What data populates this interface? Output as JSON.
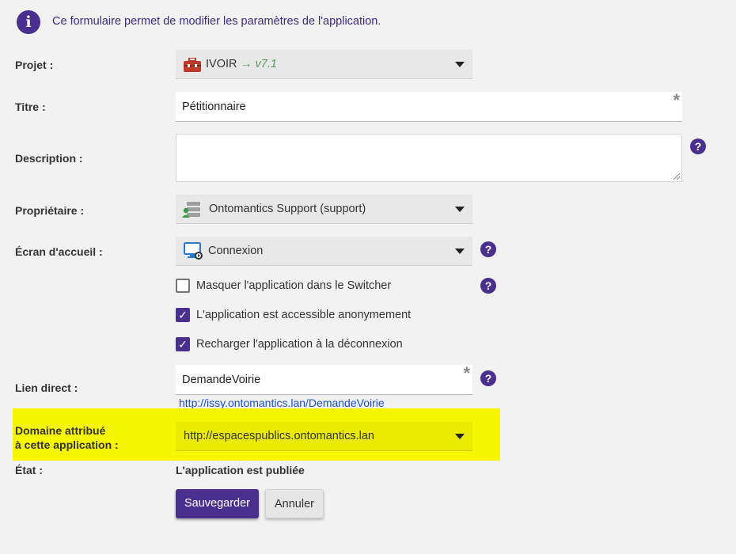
{
  "info": {
    "icon": "info-icon",
    "text": "Ce formulaire permet de modifier les paramètres de l'application."
  },
  "labels": {
    "projet": "Projet :",
    "titre": "Titre :",
    "description": "Description :",
    "proprietaire": "Propriétaire :",
    "ecran": "Écran d'accueil :",
    "lien": "Lien direct :",
    "domaine_line1": "Domaine attribué",
    "domaine_line2": "à cette application :",
    "etat": "État :"
  },
  "projet": {
    "name": "IVOIR",
    "version": "→ v7.1",
    "icon": "toolbox-icon",
    "version_color": "#5a9a5a"
  },
  "titre": {
    "value": "Pétitionnaire",
    "required_mark": "*"
  },
  "description": {
    "value": ""
  },
  "proprietaire": {
    "value": "Ontomantics Support (support)",
    "icon": "user-server-icon"
  },
  "ecran": {
    "value": "Connexion",
    "icon": "monitor-login-icon"
  },
  "checkboxes": [
    {
      "label": "Masquer l'application dans le Switcher",
      "checked": false
    },
    {
      "label": "L'application est accessible anonymement",
      "checked": true
    },
    {
      "label": "Recharger l'application à la déconnexion",
      "checked": true
    }
  ],
  "lien": {
    "value": "DemandeVoirie",
    "required_mark": "*",
    "url": "http://issy.ontomantics.lan/DemandeVoirie"
  },
  "domaine": {
    "value": "http://espacespublics.ontomantics.lan",
    "highlight_color": "#f6f600"
  },
  "etat": {
    "value": "L'application est publiée"
  },
  "buttons": {
    "save": "Sauvegarder",
    "cancel": "Annuler"
  },
  "help_glyph": "?",
  "check_glyph": "✓",
  "colors": {
    "accent": "#4a2f8f",
    "link": "#1a4fc8"
  }
}
